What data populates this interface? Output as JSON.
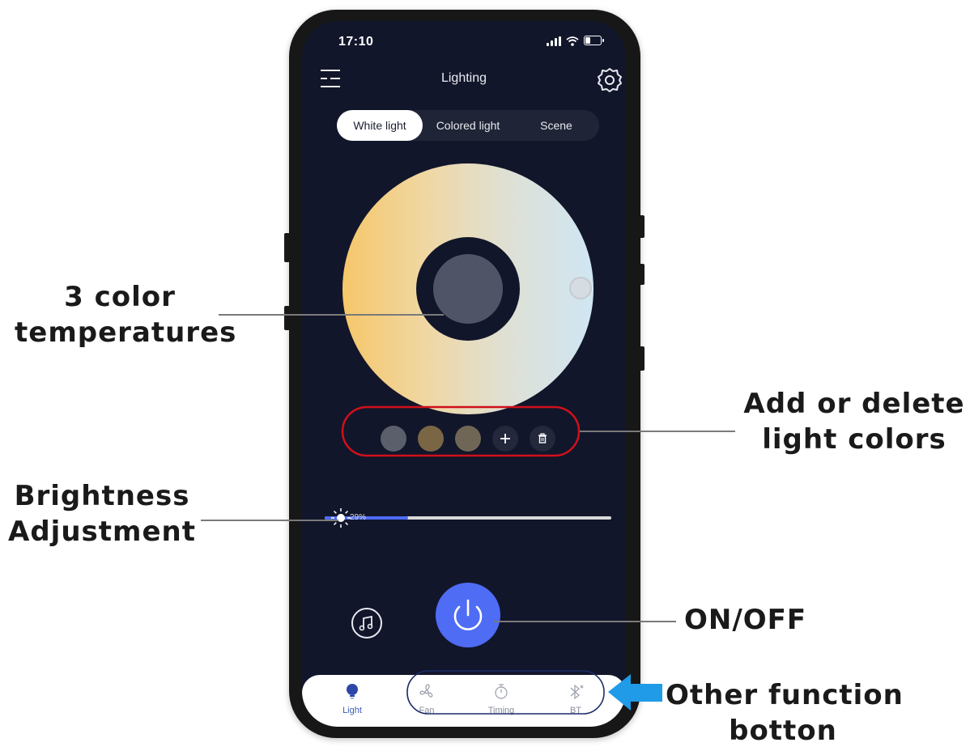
{
  "status_bar": {
    "time": "17:10"
  },
  "header": {
    "title": "Lighting"
  },
  "tabs": [
    {
      "label": "White light",
      "active": true
    },
    {
      "label": "Colored light",
      "active": false
    },
    {
      "label": "Scene",
      "active": false
    }
  ],
  "color_presets": [
    "#5a5f6b",
    "#7a6645",
    "#6f6655"
  ],
  "brightness": {
    "value_label": "29%",
    "value": 0.29
  },
  "bottom_nav": [
    {
      "label": "Light",
      "icon": "bulb-icon",
      "active": true
    },
    {
      "label": "Fan",
      "icon": "fan-icon",
      "active": false
    },
    {
      "label": "Timing",
      "icon": "timer-icon",
      "active": false
    },
    {
      "label": "BT",
      "icon": "bluetooth-off-icon",
      "active": false
    }
  ],
  "callouts": {
    "color_temp": [
      "3 color",
      "temperatures"
    ],
    "add_delete": [
      "Add or delete",
      "light colors"
    ],
    "brightness": [
      "Brightness",
      "Adjustment"
    ],
    "onoff": "ON/OFF",
    "other": [
      "Other function",
      "botton"
    ]
  },
  "colors": {
    "screen_bg": "#12162b",
    "accent_blue": "#4f6cf5",
    "highlight_red": "#d0101a",
    "highlight_navy": "#1c2d6b",
    "arrow_blue": "#1f9be8"
  }
}
